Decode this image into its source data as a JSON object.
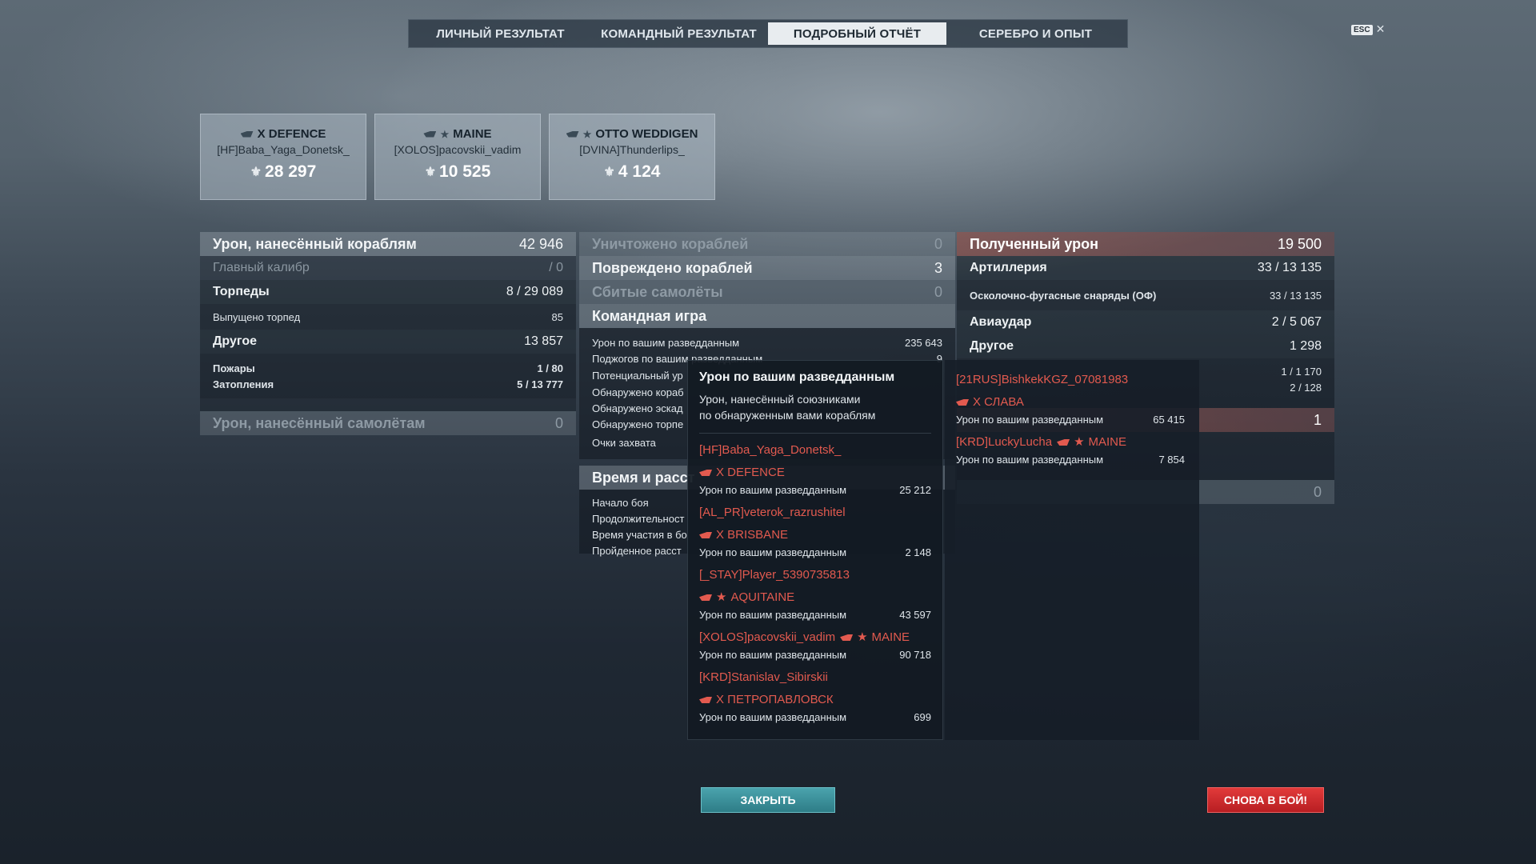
{
  "tabs": [
    {
      "label": "ЛИЧНЫЙ РЕЗУЛЬТАТ"
    },
    {
      "label": "КОМАНДНЫЙ РЕЗУЛЬТАТ"
    },
    {
      "label": "ПОДРОБНЫЙ ОТЧЁТ"
    },
    {
      "label": "СЕРЕБРО И ОПЫТ"
    }
  ],
  "active_tab": "ПОДРОБНЫЙ ОТЧЁТ",
  "esc": {
    "key": "ESC",
    "close": "✕"
  },
  "cards": [
    {
      "ship": "X DEFENCE",
      "player": "[HF]Baba_Yaga_Donetsk_",
      "score": "28 297"
    },
    {
      "ship": "MAINE",
      "player": "[XOLOS]pacovskii_vadim",
      "score": "10 525"
    },
    {
      "ship": "OTTO WEDDIGEN",
      "player": "[DVINA]Thunderlips_",
      "score": "4 124"
    }
  ],
  "col1": {
    "damage_ships": {
      "label": "Урон, нанесённый кораблям",
      "value": "42 946"
    },
    "main_caliber": {
      "label": "Главный калибр",
      "value": "/ 0"
    },
    "torpedoes": {
      "label": "Торпеды",
      "value": "8 / 29 089"
    },
    "torpedoes_fired": {
      "label": "Выпущено торпед",
      "value": "85"
    },
    "other": {
      "label": "Другое",
      "value": "13 857"
    },
    "fires": {
      "label": "Пожары",
      "value": "1 / 80"
    },
    "floods": {
      "label": "Затопления",
      "value": "5 / 13 777"
    },
    "damage_planes": {
      "label": "Урон, нанесённый самолётам",
      "value": "0"
    }
  },
  "col2": {
    "destroyed": {
      "label": "Уничтожено кораблей",
      "value": "0"
    },
    "damaged": {
      "label": "Повреждено кораблей",
      "value": "3"
    },
    "planes": {
      "label": "Сбитые самолёты",
      "value": "0"
    },
    "team_game": {
      "label": "Командная игра"
    },
    "spot_damage": {
      "label": "Урон по вашим разведданным",
      "value": "235 643"
    },
    "spot_fires": {
      "label": "Поджогов по вашим разведданным",
      "value": "9"
    },
    "potential": {
      "label": "Потенциальный ур"
    },
    "detected_ships": {
      "label": "Обнаружено кораб"
    },
    "detected_squads": {
      "label": "Обнаружено эскад"
    },
    "detected_torps": {
      "label": "Обнаружено торпе"
    },
    "capture": {
      "label": "Очки захвата"
    },
    "time_dist": {
      "label": "Время и расст"
    },
    "battle_start": {
      "label": "Начало боя"
    },
    "duration": {
      "label": "Продолжительност"
    },
    "participation": {
      "label": "Время участия в бо"
    },
    "distance": {
      "label": "Пройденное расст"
    }
  },
  "col3": {
    "received": {
      "label": "Полученный урон",
      "value": "19 500"
    },
    "artillery": {
      "label": "Артиллерия",
      "value": "33 / 13 135"
    },
    "he_shells": {
      "label": "Осколочно-фугасные снаряды (ОФ)",
      "value": "33 / 13 135"
    },
    "airstrike": {
      "label": "Авиаудар",
      "value": "2 / 5 067"
    },
    "other": {
      "label": "Другое",
      "value": "1 298"
    },
    "row_a": {
      "value": "1 / 1 170"
    },
    "row_b": {
      "value": "2 / 128"
    },
    "row_c": {
      "value": "1"
    },
    "row_d": {
      "value": "0"
    }
  },
  "popup": {
    "title": "Урон по вашим разведданным",
    "desc1": "Урон, нанесённый союзниками",
    "desc2": "по обнаруженным вами кораблям",
    "stat_label": "Урон по вашим разведданным",
    "entries": [
      {
        "player": "[HF]Baba_Yaga_Donetsk_",
        "ship": "X DEFENCE",
        "value": "25 212"
      },
      {
        "player": "[AL_PR]veterok_razrushitel",
        "ship": "X BRISBANE",
        "value": "2 148"
      },
      {
        "player": "[_STAY]Player_5390735813",
        "ship": "AQUITAINE",
        "value": "43 597"
      },
      {
        "player": "[XOLOS]pacovskii_vadim",
        "ship": "MAINE",
        "value": "90 718"
      },
      {
        "player": "[KRD]Stanislav_Sibirskii",
        "ship": "X ПЕТРОПАВЛОВСК",
        "value": "699"
      }
    ]
  },
  "rpanel": {
    "entries": [
      {
        "player": "[21RUS]BishkekKGZ_07081983",
        "ship": "X СЛАВА",
        "value": "65 415"
      },
      {
        "player": "[KRD]LuckyLucha",
        "ship": "MAINE",
        "value": "7 854"
      }
    ]
  },
  "buttons": {
    "close": "ЗАКРЫТЬ",
    "battle": "СНОВА В БОЙ!"
  },
  "colors": {
    "enemy": "#e25a4f",
    "accent_teal": "#2e7d87",
    "accent_red": "#c8232a"
  }
}
